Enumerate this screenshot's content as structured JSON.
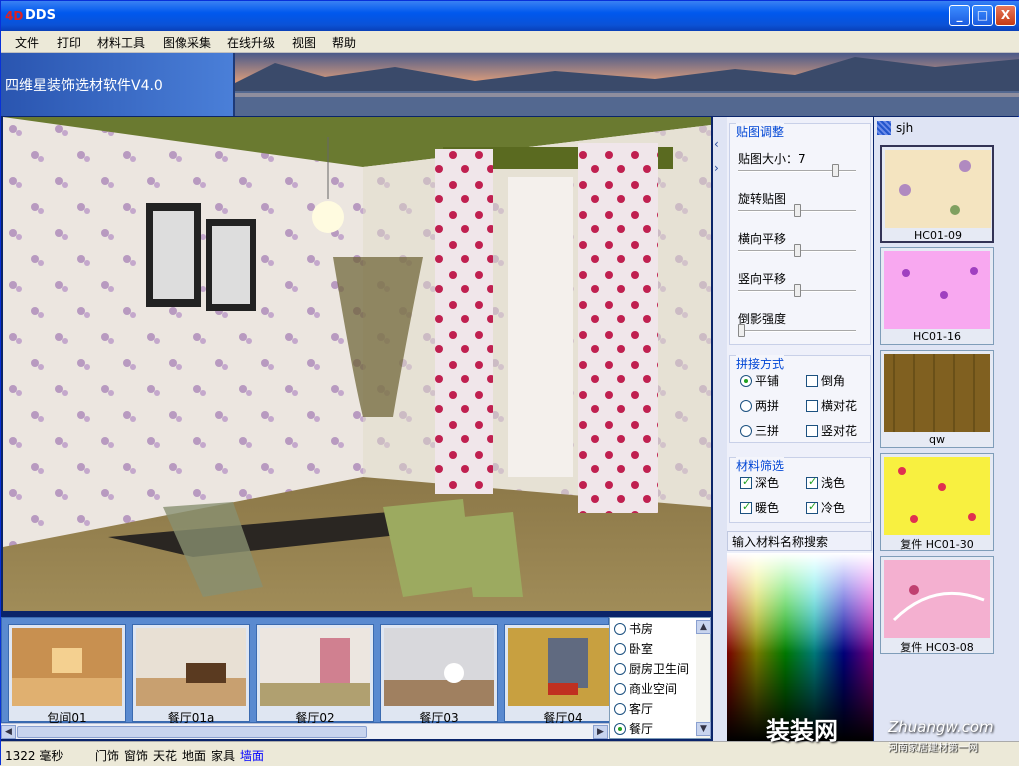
{
  "window": {
    "title": "DDS",
    "logo": "4D",
    "minimize": "_",
    "maximize": "□",
    "close": "X"
  },
  "menu": [
    "文件",
    "打印",
    "材料工具",
    "图像采集",
    "在线升级",
    "视图",
    "帮助"
  ],
  "banner": {
    "title": "四维星装饰选材软件V4.0"
  },
  "thumbnails": [
    {
      "label": "包间01"
    },
    {
      "label": "餐厅01a"
    },
    {
      "label": "餐厅02"
    },
    {
      "label": "餐厅03"
    },
    {
      "label": "餐厅04"
    }
  ],
  "rooms": [
    {
      "label": "书房",
      "selected": false
    },
    {
      "label": "卧室",
      "selected": false
    },
    {
      "label": "厨房卫生间",
      "selected": false
    },
    {
      "label": "商业空间",
      "selected": false
    },
    {
      "label": "客厅",
      "selected": false
    },
    {
      "label": "餐厅",
      "selected": true
    }
  ],
  "adjust": {
    "title": "贴图调整",
    "size_label": "贴图大小：7",
    "rotate_label": "旋转贴图",
    "hshift_label": "横向平移",
    "vshift_label": "竖向平移",
    "shadow_label": "倒影强度",
    "size_level": 0.85,
    "rotate_level": 0.5,
    "hshift_level": 0.5,
    "vshift_level": 0.5,
    "shadow_level": 0.0
  },
  "tiling": {
    "title": "拼接方式",
    "flat": "平铺",
    "two": "两拼",
    "three": "三拼",
    "bevel": "倒角",
    "hpattern": "横对花",
    "vpattern": "竖对花"
  },
  "filter": {
    "title": "材料筛选",
    "dark": "深色",
    "light": "浅色",
    "warm": "暖色",
    "cool": "冷色"
  },
  "search": {
    "label": "输入材料名称搜索"
  },
  "materials": {
    "user": "sjh",
    "items": [
      {
        "label": "HC01-09"
      },
      {
        "label": "HC01-16"
      },
      {
        "label": "qw"
      },
      {
        "label": "复件 HC01-30"
      },
      {
        "label": "复件 HC03-08"
      }
    ]
  },
  "status": {
    "time": "1322 毫秒",
    "doors": "门饰",
    "windows": "窗饰",
    "ceiling": "天花",
    "floor": "地面",
    "furniture": "家具",
    "wall": "墙面"
  },
  "watermark": {
    "brand": "装装网",
    "url": "Zhuangw.com",
    "tagline": "河南家居建材第一网"
  },
  "colors": {
    "accent": "#0046d5",
    "titlebar": "#0058ee",
    "wall_active": "#0000ff"
  }
}
